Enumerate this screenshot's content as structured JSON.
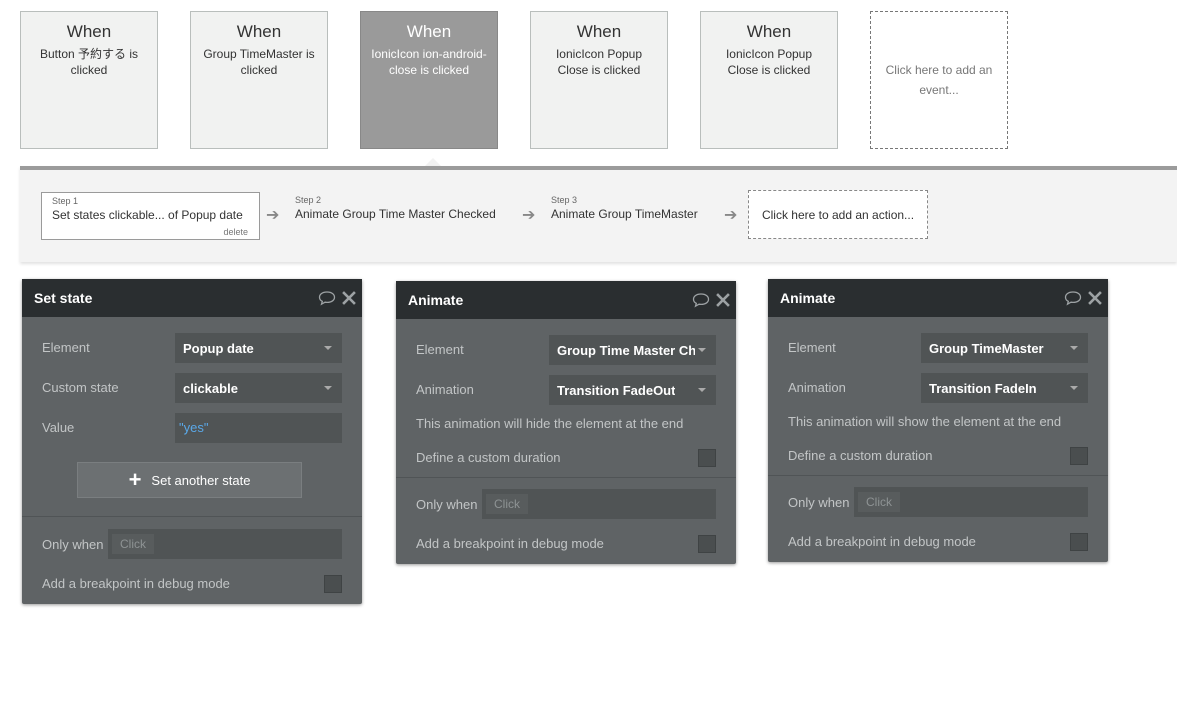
{
  "events": [
    {
      "when": "When",
      "description": "Button 予約する is clicked",
      "selected": false
    },
    {
      "when": "When",
      "description": "Group TimeMaster is clicked",
      "selected": false
    },
    {
      "when": "When",
      "description": "IonicIcon ion-android-close is clicked",
      "selected": true
    },
    {
      "when": "When",
      "description": "IonicIcon Popup Close is clicked",
      "selected": false
    },
    {
      "when": "When",
      "description": "IonicIcon Popup Close is clicked",
      "selected": false
    }
  ],
  "add_event_label": "Click here to add an event...",
  "steps": [
    {
      "number": "Step 1",
      "title": "Set states clickable... of Popup date",
      "delete_label": "delete"
    },
    {
      "number": "Step 2",
      "title": "Animate Group Time Master Checked"
    },
    {
      "number": "Step 3",
      "title": "Animate Group TimeMaster"
    }
  ],
  "add_action_label": "Click here to add an action...",
  "set_state_panel": {
    "title": "Set state",
    "element_label": "Element",
    "element_value": "Popup date",
    "custom_state_label": "Custom state",
    "custom_state_value": "clickable",
    "value_label": "Value",
    "value_value": "\"yes\"",
    "add_state_label": "Set another state",
    "only_when_label": "Only when",
    "only_when_placeholder": "Click",
    "breakpoint_label": "Add a breakpoint in debug mode"
  },
  "animate_panel_1": {
    "title": "Animate",
    "element_label": "Element",
    "element_value": "Group Time Master Ch...",
    "animation_label": "Animation",
    "animation_value": "Transition FadeOut",
    "note": "This animation will hide the element at the end",
    "custom_duration_label": "Define a custom duration",
    "only_when_label": "Only when",
    "only_when_placeholder": "Click",
    "breakpoint_label": "Add a breakpoint in debug mode"
  },
  "animate_panel_2": {
    "title": "Animate",
    "element_label": "Element",
    "element_value": "Group TimeMaster",
    "animation_label": "Animation",
    "animation_value": "Transition FadeIn",
    "note": "This animation will show the element at the end",
    "custom_duration_label": "Define a custom duration",
    "only_when_label": "Only when",
    "only_when_placeholder": "Click",
    "breakpoint_label": "Add a breakpoint in debug mode"
  },
  "icons": {
    "comment": "comment-icon",
    "close": "close-icon",
    "arrow": "arrow-right-icon",
    "caret": "chevron-down-icon",
    "plus": "plus-icon"
  },
  "colors": {
    "panel_bg": "#5f6365",
    "panel_header": "#2a2e30",
    "selected_event": "#9a9a9a",
    "value_blue": "#5aa8e8"
  }
}
